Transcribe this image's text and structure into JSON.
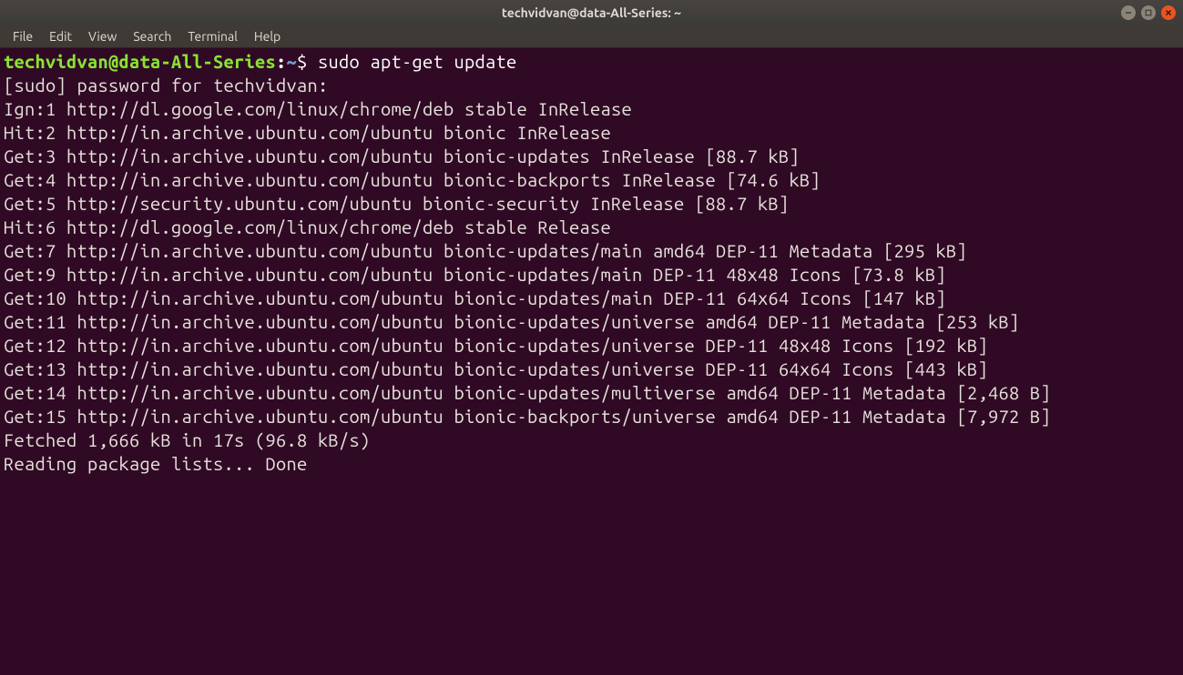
{
  "titlebar": {
    "title": "techvidvan@data-All-Series: ~"
  },
  "menubar": {
    "items": [
      "File",
      "Edit",
      "View",
      "Search",
      "Terminal",
      "Help"
    ]
  },
  "prompt": {
    "user_host": "techvidvan@data-All-Series",
    "separator": ":",
    "path": "~",
    "dollar": "$",
    "command": "sudo apt-get update"
  },
  "output": [
    "[sudo] password for techvidvan:",
    "Ign:1 http://dl.google.com/linux/chrome/deb stable InRelease",
    "Hit:2 http://in.archive.ubuntu.com/ubuntu bionic InRelease",
    "Get:3 http://in.archive.ubuntu.com/ubuntu bionic-updates InRelease [88.7 kB]",
    "Get:4 http://in.archive.ubuntu.com/ubuntu bionic-backports InRelease [74.6 kB]",
    "Get:5 http://security.ubuntu.com/ubuntu bionic-security InRelease [88.7 kB]",
    "Hit:6 http://dl.google.com/linux/chrome/deb stable Release",
    "Get:7 http://in.archive.ubuntu.com/ubuntu bionic-updates/main amd64 DEP-11 Metadata [295 kB]",
    "Get:9 http://in.archive.ubuntu.com/ubuntu bionic-updates/main DEP-11 48x48 Icons [73.8 kB]",
    "Get:10 http://in.archive.ubuntu.com/ubuntu bionic-updates/main DEP-11 64x64 Icons [147 kB]",
    "Get:11 http://in.archive.ubuntu.com/ubuntu bionic-updates/universe amd64 DEP-11 Metadata [253 kB]",
    "Get:12 http://in.archive.ubuntu.com/ubuntu bionic-updates/universe DEP-11 48x48 Icons [192 kB]",
    "Get:13 http://in.archive.ubuntu.com/ubuntu bionic-updates/universe DEP-11 64x64 Icons [443 kB]",
    "Get:14 http://in.archive.ubuntu.com/ubuntu bionic-updates/multiverse amd64 DEP-11 Metadata [2,468 B]",
    "Get:15 http://in.archive.ubuntu.com/ubuntu bionic-backports/universe amd64 DEP-11 Metadata [7,972 B]",
    "Fetched 1,666 kB in 17s (96.8 kB/s)",
    "Reading package lists... Done"
  ]
}
